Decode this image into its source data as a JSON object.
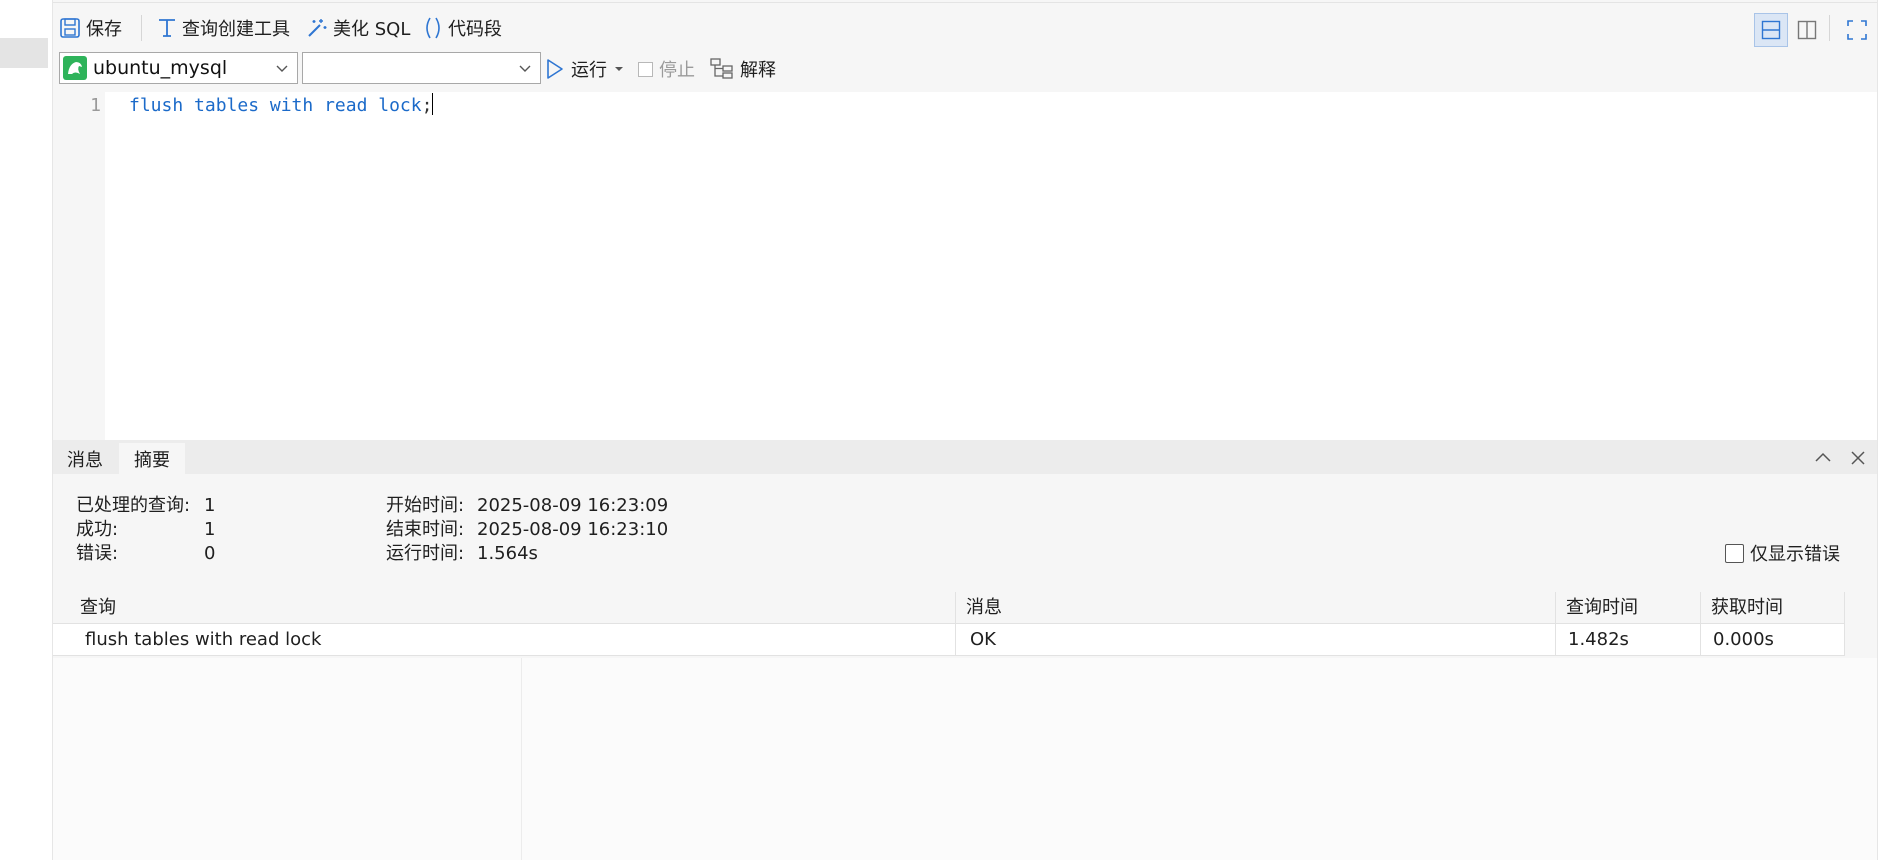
{
  "toolbar": {
    "save_label": "保存",
    "query_builder_label": "查询创建工具",
    "beautify_label": "美化 SQL",
    "snippet_label": "代码段"
  },
  "connection": {
    "selected": "ubuntu_mysql",
    "database": ""
  },
  "run_bar": {
    "run_label": "运行",
    "stop_label": "停止",
    "explain_label": "解释"
  },
  "editor": {
    "lines": [
      {
        "number": "1",
        "code": "flush tables with read lock",
        "terminator": ";"
      }
    ]
  },
  "results": {
    "tabs": [
      "消息",
      "摘要"
    ],
    "active_tab": "摘要",
    "summary": {
      "processed_label": "已处理的查询:",
      "processed_value": "1",
      "success_label": "成功:",
      "success_value": "1",
      "errors_label": "错误:",
      "errors_value": "0",
      "start_label": "开始时间:",
      "start_value": "2025-08-09 16:23:09",
      "end_label": "结束时间:",
      "end_value": "2025-08-09 16:23:10",
      "runtime_label": "运行时间:",
      "runtime_value": "1.564s"
    },
    "only_errors_label": "仅显示错误",
    "only_errors_checked": false,
    "columns": [
      "查询",
      "消息",
      "查询时间",
      "获取时间"
    ],
    "rows": [
      [
        "flush tables with read lock",
        "OK",
        "1.482s",
        "0.000s"
      ]
    ]
  },
  "colors": {
    "keyword": "#1b6ac9",
    "run_icon": "#2f76d2",
    "connection_icon": "#2eb35a",
    "view_active": "#dbe6f5"
  },
  "icons": {
    "save": "floppy-disk-icon",
    "query_builder": "query-builder-icon",
    "beautify": "magic-wand-icon",
    "snippet": "parentheses-icon",
    "run": "play-icon",
    "explain": "explain-tree-icon",
    "connection": "mysql-dolphin-icon"
  }
}
